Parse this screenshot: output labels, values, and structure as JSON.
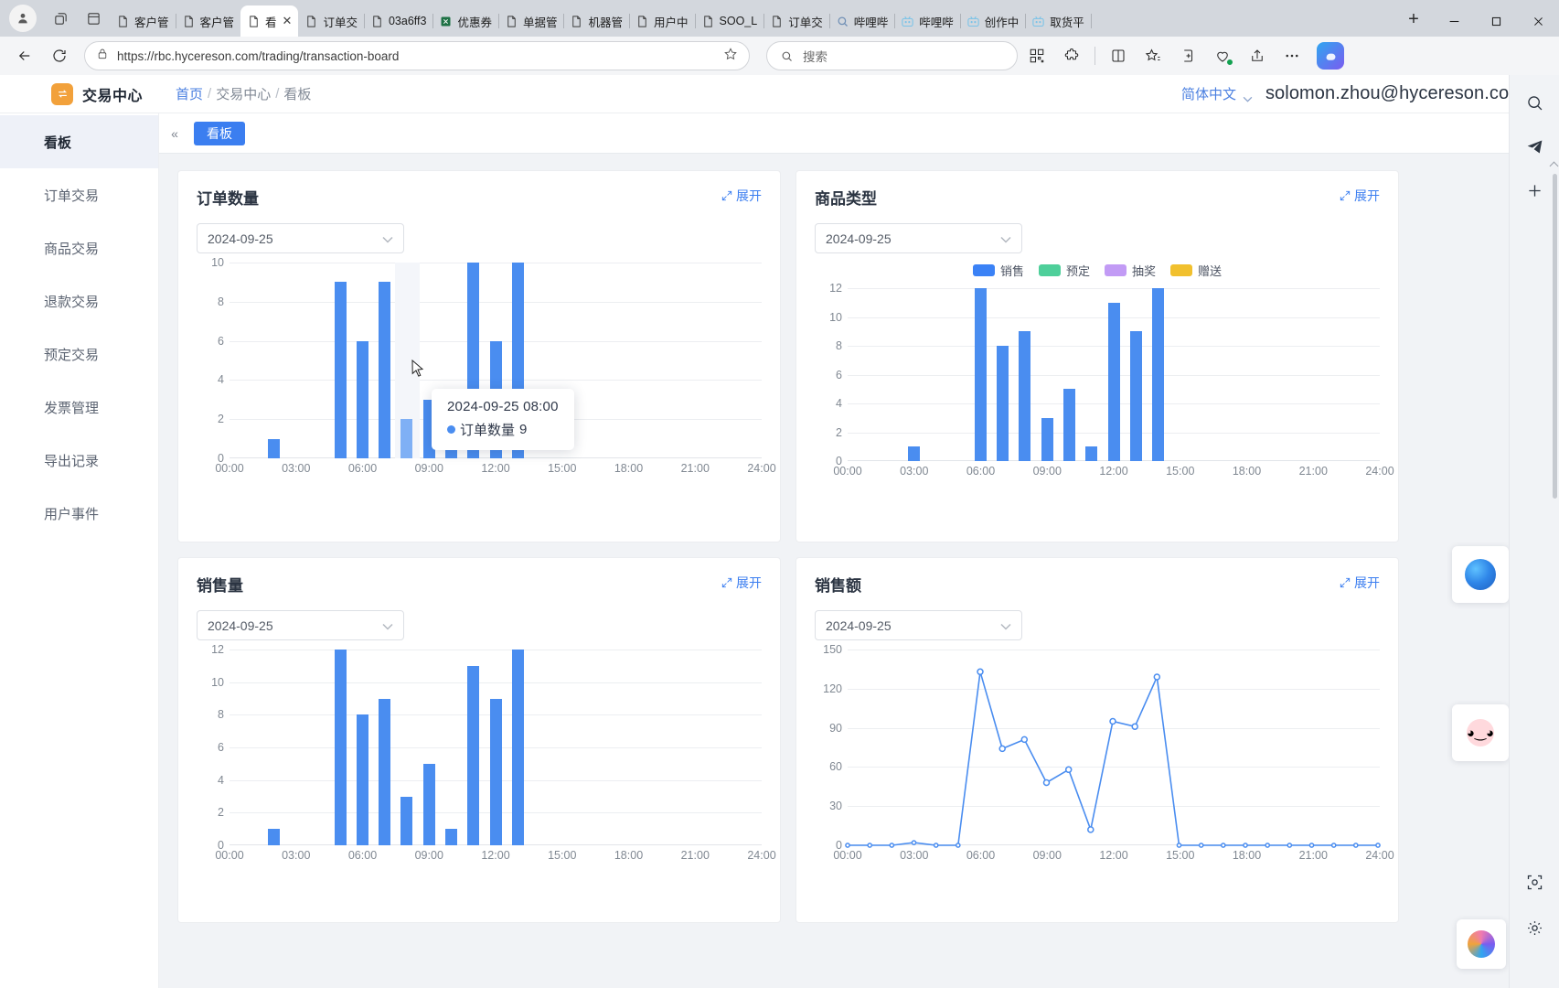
{
  "browser": {
    "tabs": [
      {
        "title": "客户管",
        "icon": "page-icon",
        "active": false
      },
      {
        "title": "客户管",
        "icon": "page-icon",
        "active": false
      },
      {
        "title": "看",
        "icon": "page-icon",
        "active": true,
        "close": "✕"
      },
      {
        "title": "订单交",
        "icon": "page-icon",
        "active": false
      },
      {
        "title": "03a6ff3",
        "icon": "page-icon",
        "active": false
      },
      {
        "title": "优惠券",
        "icon": "excel-icon",
        "active": false
      },
      {
        "title": "单据管",
        "icon": "page-icon",
        "active": false
      },
      {
        "title": "机器管",
        "icon": "page-icon",
        "active": false
      },
      {
        "title": "用户中",
        "icon": "page-icon",
        "active": false
      },
      {
        "title": "SOO_L",
        "icon": "page-icon",
        "active": false
      },
      {
        "title": "订单交",
        "icon": "page-icon",
        "active": false
      },
      {
        "title": "哔哩哔",
        "icon": "search-icon",
        "active": false
      },
      {
        "title": "哔哩哔",
        "icon": "bilibili-icon",
        "active": false
      },
      {
        "title": "创作中",
        "icon": "bilibili-icon",
        "active": false
      },
      {
        "title": "取货平",
        "icon": "bilibili-icon",
        "active": false
      }
    ],
    "new_tab_label": "+",
    "window_controls": {
      "minimize": "—",
      "maximize": "▢",
      "close": "✕"
    },
    "url": "https://rbc.hycereson.com/trading/transaction-board",
    "search_placeholder": "搜索"
  },
  "app": {
    "brand": "交易中心",
    "breadcrumb": {
      "home": "首页",
      "section": "交易中心",
      "current": "看板",
      "sep": "/"
    },
    "language": "简体中文",
    "user_email": "solomon.zhou@hycereson.com",
    "page_tab": "看板",
    "collapse_left": "«",
    "collapse_right": "»"
  },
  "sidebar": {
    "items": [
      {
        "label": "看板",
        "active": true
      },
      {
        "label": "订单交易",
        "active": false
      },
      {
        "label": "商品交易",
        "active": false
      },
      {
        "label": "退款交易",
        "active": false
      },
      {
        "label": "预定交易",
        "active": false
      },
      {
        "label": "发票管理",
        "active": false
      },
      {
        "label": "导出记录",
        "active": false
      },
      {
        "label": "用户事件",
        "active": false
      }
    ]
  },
  "cards": [
    {
      "title": "订单数量",
      "expand": "展开",
      "date": "2024-09-25"
    },
    {
      "title": "商品类型",
      "expand": "展开",
      "date": "2024-09-25"
    },
    {
      "title": "销售量",
      "expand": "展开",
      "date": "2024-09-25"
    },
    {
      "title": "销售额",
      "expand": "展开",
      "date": "2024-09-25"
    }
  ],
  "legend": [
    {
      "label": "销售",
      "color": "#3b82f6"
    },
    {
      "label": "预定",
      "color": "#4ecf9a"
    },
    {
      "label": "抽奖",
      "color": "#c29bf5"
    },
    {
      "label": "赠送",
      "color": "#f1c02e"
    }
  ],
  "tooltip": {
    "time": "2024-09-25 08:00",
    "series": "订单数量",
    "value": "9"
  },
  "chart_data": [
    {
      "type": "bar",
      "title": "订单数量",
      "xlabel": "",
      "ylabel": "",
      "ylim": [
        0,
        10
      ],
      "yticks": [
        0,
        2,
        4,
        6,
        8,
        10
      ],
      "xticks": [
        "00:00",
        "03:00",
        "06:00",
        "09:00",
        "12:00",
        "15:00",
        "18:00",
        "21:00",
        "24:00"
      ],
      "x": [
        "02:00",
        "05:00",
        "06:00",
        "07:00",
        "08:00",
        "09:00",
        "10:00",
        "11:00",
        "12:00",
        "13:00",
        "14:00"
      ],
      "categories": [
        "02:00",
        "05:00",
        "06:00",
        "07:00",
        "08:00",
        "09:00",
        "10:00",
        "11:00",
        "12:00",
        "13:00",
        "14:00"
      ],
      "values": [
        1,
        9,
        6,
        9,
        2,
        3,
        1,
        10,
        6,
        10,
        0
      ],
      "highlight_index": 4,
      "grid": true,
      "legend": false,
      "color": "#4a8df0"
    },
    {
      "type": "bar",
      "title": "商品类型",
      "xlabel": "",
      "ylabel": "",
      "ylim": [
        0,
        12
      ],
      "yticks": [
        0,
        2,
        4,
        6,
        8,
        10,
        12
      ],
      "xticks": [
        "00:00",
        "03:00",
        "06:00",
        "09:00",
        "12:00",
        "15:00",
        "18:00",
        "21:00",
        "24:00"
      ],
      "x": [
        "03:00",
        "06:00",
        "07:00",
        "08:00",
        "09:00",
        "10:00",
        "11:00",
        "12:00",
        "13:00",
        "14:00"
      ],
      "categories": [
        "03:00",
        "06:00",
        "07:00",
        "08:00",
        "09:00",
        "10:00",
        "11:00",
        "12:00",
        "13:00",
        "14:00"
      ],
      "series": [
        {
          "name": "销售",
          "values": [
            1,
            12,
            8,
            9,
            3,
            5,
            1,
            11,
            9,
            12
          ],
          "color": "#4a8df0"
        },
        {
          "name": "预定",
          "values": [
            0,
            0,
            0,
            0,
            0,
            0,
            0,
            0,
            0,
            0
          ],
          "color": "#4ecf9a"
        },
        {
          "name": "抽奖",
          "values": [
            0,
            0,
            0,
            0,
            0,
            0,
            0,
            0,
            0,
            0
          ],
          "color": "#c29bf5"
        },
        {
          "name": "赠送",
          "values": [
            0,
            0,
            0,
            0,
            0,
            0,
            0,
            0,
            0,
            0
          ],
          "color": "#f1c02e"
        }
      ],
      "grid": true,
      "legend": true,
      "legend_position": "top"
    },
    {
      "type": "bar",
      "title": "销售量",
      "xlabel": "",
      "ylabel": "",
      "ylim": [
        0,
        12
      ],
      "yticks": [
        0,
        2,
        4,
        6,
        8,
        10,
        12
      ],
      "xticks": [
        "00:00",
        "03:00",
        "06:00",
        "09:00",
        "12:00",
        "15:00",
        "18:00",
        "21:00",
        "24:00"
      ],
      "x": [
        "02:00",
        "05:00",
        "06:00",
        "07:00",
        "08:00",
        "09:00",
        "10:00",
        "11:00",
        "12:00",
        "13:00",
        "14:00"
      ],
      "categories": [
        "02:00",
        "05:00",
        "06:00",
        "07:00",
        "08:00",
        "09:00",
        "10:00",
        "11:00",
        "12:00",
        "13:00",
        "14:00"
      ],
      "values": [
        1,
        12,
        8,
        9,
        3,
        5,
        1,
        11,
        9,
        12,
        0
      ],
      "grid": true,
      "legend": false,
      "color": "#4a8df0"
    },
    {
      "type": "line",
      "title": "销售额",
      "xlabel": "",
      "ylabel": "",
      "ylim": [
        0,
        150
      ],
      "yticks": [
        0,
        30,
        60,
        90,
        120,
        150
      ],
      "xticks": [
        "00:00",
        "03:00",
        "06:00",
        "09:00",
        "12:00",
        "15:00",
        "18:00",
        "21:00",
        "24:00"
      ],
      "x": [
        "00:00",
        "01:00",
        "02:00",
        "03:00",
        "04:00",
        "05:00",
        "06:00",
        "07:00",
        "08:00",
        "09:00",
        "10:00",
        "11:00",
        "12:00",
        "13:00",
        "14:00",
        "15:00",
        "16:00",
        "17:00",
        "18:00",
        "19:00",
        "20:00",
        "21:00",
        "22:00",
        "23:00",
        "24:00"
      ],
      "values": [
        0,
        0,
        0,
        2,
        0,
        0,
        133,
        74,
        81,
        48,
        58,
        12,
        95,
        91,
        129,
        0,
        0,
        0,
        0,
        0,
        0,
        0,
        0,
        0,
        0
      ],
      "grid": true,
      "legend": false,
      "color": "#4a8df0"
    }
  ]
}
